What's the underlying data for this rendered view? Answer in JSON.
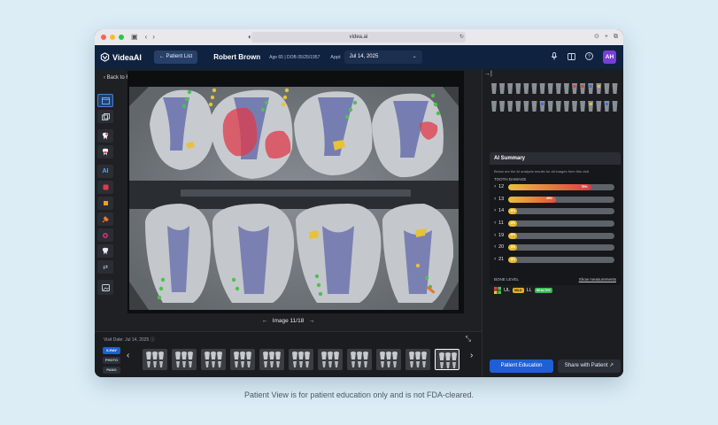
{
  "browser": {
    "url": "videa.ai"
  },
  "header": {
    "brand": "VideaAI",
    "patient_list_label": "Patient List",
    "patient_name": "Robert Brown",
    "patient_meta": "Age 65 | DOB 05/25/1957",
    "appt_label": "Appt",
    "appt_value": "Jul 14, 2025",
    "avatar": "AH"
  },
  "main": {
    "back_label": "Back to FMX",
    "image_counter": "Image  11/18",
    "toolbar_items": [
      {
        "name": "layout-single-icon"
      },
      {
        "name": "layout-compare-icon"
      },
      {
        "name": "tooth-highlight-icon"
      },
      {
        "name": "tooth-outline-icon"
      },
      {
        "name": "ai-toggle",
        "label": "AI"
      },
      {
        "name": "caries-icon"
      },
      {
        "name": "calculus-icon"
      },
      {
        "name": "restoration-icon"
      },
      {
        "name": "lesion-icon"
      },
      {
        "name": "tooth-number-icon"
      },
      {
        "name": "swap-icon"
      },
      {
        "name": "image-settings-icon"
      }
    ]
  },
  "strip": {
    "visit_date": "Visit Date: Jul 14, 2025",
    "modalities": [
      "X-RAY",
      "PHOTO",
      "PANO"
    ],
    "active_modality": "X-RAY",
    "thumbnails": [
      "",
      "",
      "",
      "",
      "",
      "",
      "",
      "",
      "",
      "",
      ""
    ],
    "selected_thumb": 10
  },
  "panel": {
    "ai_title": "AI Summary",
    "ai_subtitle": "Below are the AI analysis results for all images from this visit.",
    "damage_title": "TOOTH DAMAGE",
    "damage": [
      {
        "tooth": "12",
        "pct": 78,
        "label": "78%",
        "color": "#e03a4a"
      },
      {
        "tooth": "13",
        "pct": 45,
        "label": "45%",
        "color": "#e84e3a"
      },
      {
        "tooth": "14",
        "pct": 8,
        "label": "8%",
        "color": "#e3b42a"
      },
      {
        "tooth": "11",
        "pct": 8,
        "label": "8%",
        "color": "#e3b42a"
      },
      {
        "tooth": "19",
        "pct": 8,
        "label": "8%",
        "color": "#e3b42a"
      },
      {
        "tooth": "20",
        "pct": 8,
        "label": "8%",
        "color": "#e3b42a"
      },
      {
        "tooth": "21",
        "pct": 8,
        "label": "8%",
        "color": "#e3b42a"
      }
    ],
    "bone_title": "BONE LEVEL",
    "bone_link": "Show measurements",
    "bone_ul": "UL",
    "bone_ul_badge": "MILD",
    "bone_ll": "LL",
    "bone_ll_badge": "HEALTHY",
    "btn_education": "Patient Education",
    "btn_share": "Share with Patient"
  },
  "footer": {
    "disclaimer": "Patient View is for patient education only and is not FDA-cleared."
  }
}
